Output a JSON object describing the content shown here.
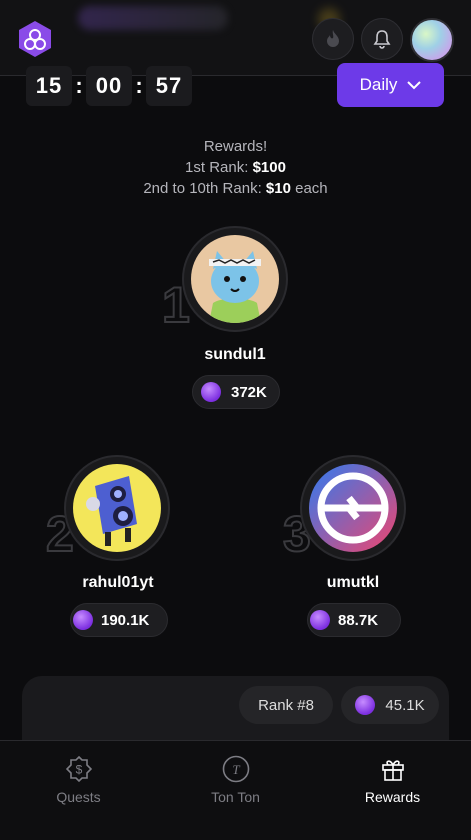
{
  "timer": {
    "hours": "15",
    "minutes": "00",
    "seconds": "57"
  },
  "period": {
    "label": "Daily"
  },
  "rewards": {
    "title": "Rewards!",
    "first_prefix": "1st Rank: ",
    "first_amount": "$100",
    "rest_prefix": "2nd to 10th Rank: ",
    "rest_amount": "$10",
    "rest_suffix": " each"
  },
  "leaders": [
    {
      "rank": "1",
      "name": "sundul1",
      "score": "372K"
    },
    {
      "rank": "2",
      "name": "rahul01yt",
      "score": "190.1K"
    },
    {
      "rank": "3",
      "name": "umutkl",
      "score": "88.7K"
    }
  ],
  "me": {
    "rank_label": "Rank #8",
    "score": "45.1K"
  },
  "nav": [
    {
      "label": "Quests",
      "icon": "dollar-badge-icon"
    },
    {
      "label": "Ton Ton",
      "icon": "ton-token-icon"
    },
    {
      "label": "Rewards",
      "icon": "gift-icon"
    }
  ],
  "colors": {
    "accent": "#6d3ae8",
    "gem": "#9b45f0",
    "background": "#0c0c0e"
  }
}
